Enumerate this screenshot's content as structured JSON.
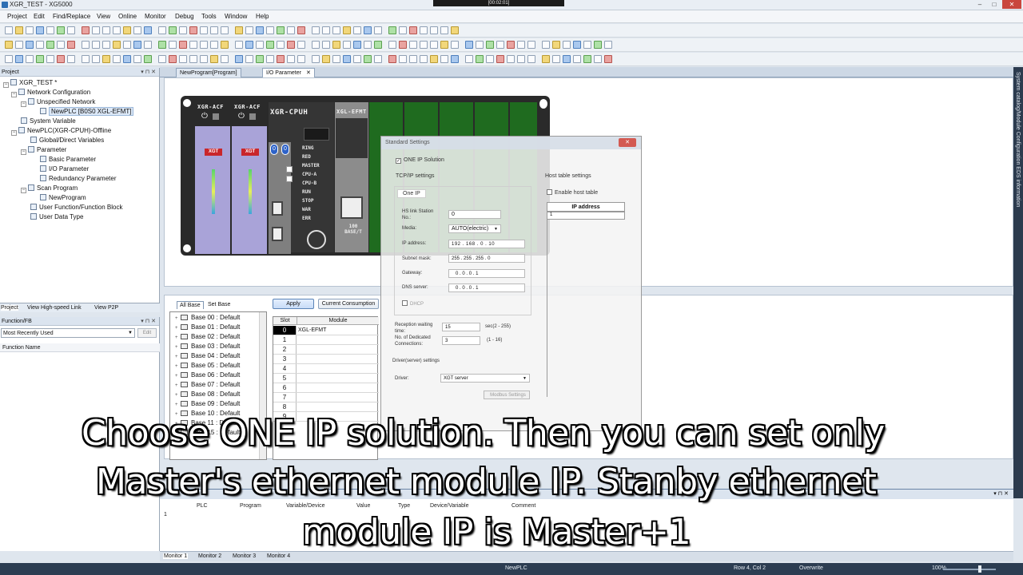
{
  "window": {
    "title": "XGR_TEST - XG5000",
    "video_timestamp": "[00:02:01]"
  },
  "menu": [
    "Project",
    "Edit",
    "Find/Replace",
    "View",
    "Online",
    "Monitor",
    "Debug",
    "Tools",
    "Window",
    "Help"
  ],
  "project_panel": {
    "header": "Project",
    "tree": [
      {
        "label": "XGR_TEST *",
        "level": 0
      },
      {
        "label": "Network Configuration",
        "level": 1
      },
      {
        "label": "Unspecified Network",
        "level": 2
      },
      {
        "label": "NewPLC [B0S0 XGL-EFMT]",
        "level": 3
      },
      {
        "label": "System Variable",
        "level": 1
      },
      {
        "label": "NewPLC(XGR-CPUH)-Offline",
        "level": 1
      },
      {
        "label": "Global/Direct Variables",
        "level": 2
      },
      {
        "label": "Parameter",
        "level": 2
      },
      {
        "label": "Basic Parameter",
        "level": 3
      },
      {
        "label": "I/O Parameter",
        "level": 3
      },
      {
        "label": "Redundancy Parameter",
        "level": 3
      },
      {
        "label": "Scan Program",
        "level": 2
      },
      {
        "label": "NewProgram",
        "level": 3
      },
      {
        "label": "User Function/Function Block",
        "level": 2
      },
      {
        "label": "User Data Type",
        "level": 2
      }
    ],
    "tabs": [
      "Project",
      "View High-speed Link",
      "View P2P"
    ]
  },
  "function_panel": {
    "header": "Function/FB",
    "dropdown": "Most Recently Used",
    "edit_label": "Edit",
    "column": "Function Name"
  },
  "editor_tabs": [
    {
      "label": "NewProgram[Program]",
      "active": false
    },
    {
      "label": "I/O Parameter",
      "active": true
    }
  ],
  "right_strip": "System catalog/Module Configuration EDS information",
  "rack": {
    "modules": [
      "XGR-ACF",
      "XGR-ACF",
      "XGR-CPUH",
      "XGL-EFMT"
    ],
    "badge": "XGT",
    "leds": [
      "RING",
      "RED",
      "MASTER",
      "CPU-A",
      "CPU-B",
      "RUN",
      "STOP",
      "WAR",
      "ERR"
    ],
    "port_label": "100 BASE/T"
  },
  "dialog": {
    "title": "Standard Settings",
    "one_ip_solution": "ONE IP Solution",
    "tcpip_settings": "TCP/IP settings",
    "tab": "One IP",
    "hs_link_station_label": "HS link Station No.:",
    "hs_link_station": "0",
    "media_label": "Media:",
    "media": "AUTO(electric)",
    "ip_label": "IP address:",
    "ip": [
      "192",
      "168",
      "0",
      "10"
    ],
    "subnet_label": "Subnet mask:",
    "subnet": [
      "255",
      "255",
      "255",
      "0"
    ],
    "gateway_label": "Gateway:",
    "gateway": [
      "0",
      "0",
      "0",
      "1"
    ],
    "dns_label": "DNS server:",
    "dns": [
      "0",
      "0",
      "0",
      "1"
    ],
    "dhcp": "DHCP",
    "reception_label": "Reception waiting time:",
    "reception": "15",
    "reception_range": "sec(2 - 255)",
    "dedicated_label": "No. of Dedicated Connections:",
    "dedicated": "3",
    "dedicated_range": "(1 - 16)",
    "driver_section": "Driver(server) settings",
    "driver_label": "Driver:",
    "driver": "XGT server",
    "modbus_button": "Modbus Settings",
    "host_table_settings": "Host table settings",
    "enable_host_table": "Enable host table",
    "host_col": "IP address",
    "host_row": "1"
  },
  "io_config": {
    "tabs": [
      "All Base",
      "Set Base"
    ],
    "apply": "Apply",
    "consumption": "Current Consumption",
    "bases": [
      "Base 00 : Default",
      "Base 01 : Default",
      "Base 02 : Default",
      "Base 03 : Default",
      "Base 04 : Default",
      "Base 05 : Default",
      "Base 06 : Default",
      "Base 07 : Default",
      "Base 08 : Default",
      "Base 09 : Default",
      "Base 10 : Default",
      "Base 11 : Default",
      "Base 15 : Default"
    ],
    "slot_header": "Slot",
    "module_header": "Module",
    "slots": [
      "0",
      "1",
      "2",
      "3",
      "4",
      "5",
      "6",
      "7",
      "8",
      "9"
    ],
    "slot0_module": "XGL-EFMT"
  },
  "monitor": {
    "columns": [
      "PLC",
      "Program",
      "Variable/Device",
      "Value",
      "Type",
      "Device/Variable",
      "Comment"
    ],
    "row": "1",
    "tabs": [
      "Monitor 1",
      "Monitor 2",
      "Monitor 3",
      "Monitor 4"
    ]
  },
  "status": {
    "plc": "NewPLC",
    "position": "Row 4, Col 2",
    "mode": "Overwrite",
    "zoom": "100%"
  },
  "caption": {
    "line1": "Choose ONE IP solution. Then you can set only",
    "line2": "Master's ethernet module IP. Stanby ethernet",
    "line3": "module IP is Master+1"
  }
}
